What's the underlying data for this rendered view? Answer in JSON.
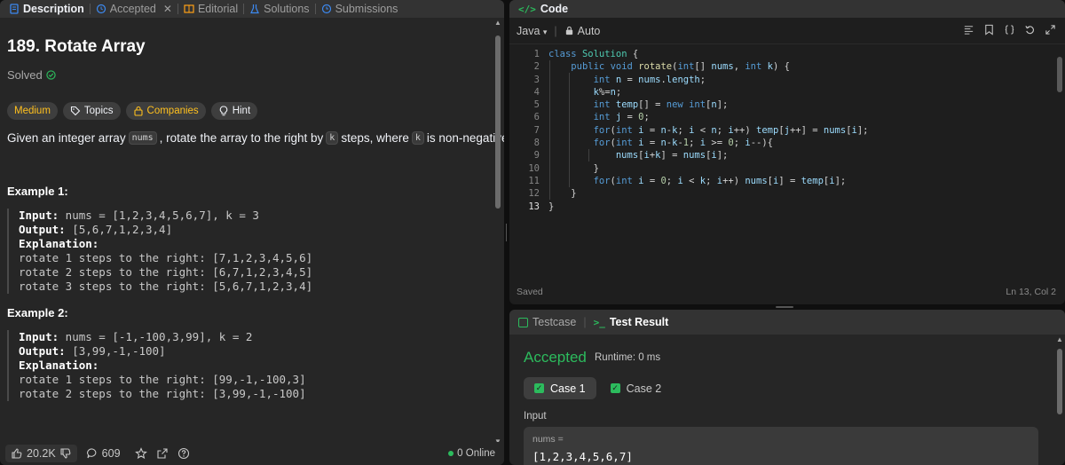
{
  "left_tabs": [
    {
      "label": "Description",
      "icon": "document-icon",
      "active": true
    },
    {
      "label": "Accepted",
      "icon": "history-icon",
      "closable": true
    },
    {
      "label": "Editorial",
      "icon": "book-icon"
    },
    {
      "label": "Solutions",
      "icon": "flask-icon"
    },
    {
      "label": "Submissions",
      "icon": "clock-icon"
    }
  ],
  "problem": {
    "title": "189. Rotate Array",
    "solved_label": "Solved",
    "chips": {
      "difficulty": "Medium",
      "topics": "Topics",
      "companies": "Companies",
      "hint": "Hint"
    },
    "desc": {
      "part1": "Given an integer array",
      "code1": "nums",
      "part2": ", rotate the array to the right by",
      "code2": "k",
      "part3": "steps, where",
      "code3": "k",
      "part4": "is non-negative."
    },
    "example1": {
      "title": "Example 1:",
      "input_label": "Input:",
      "input_value": " nums = [1,2,3,4,5,6,7], k = 3",
      "output_label": "Output:",
      "output_value": " [5,6,7,1,2,3,4]",
      "explanation_label": "Explanation:",
      "lines": [
        "rotate 1 steps to the right: [7,1,2,3,4,5,6]",
        "rotate 2 steps to the right: [6,7,1,2,3,4,5]",
        "rotate 3 steps to the right: [5,6,7,1,2,3,4]"
      ]
    },
    "example2": {
      "title": "Example 2:",
      "input_label": "Input:",
      "input_value": " nums = [-1,-100,3,99], k = 2",
      "output_label": "Output:",
      "output_value": " [3,99,-1,-100]",
      "explanation_label": "Explanation:",
      "lines": [
        "rotate 1 steps to the right: [99,-1,-100,3]",
        "rotate 2 steps to the right: [3,99,-1,-100]"
      ]
    }
  },
  "bottom_bar": {
    "likes": "20.2K",
    "comments": "609",
    "online": "0 Online"
  },
  "code_panel": {
    "title": "Code",
    "language": "Java",
    "mode": "Auto",
    "status": "Saved",
    "cursor": "Ln 13, Col 2",
    "line_numbers": [
      "1",
      "2",
      "3",
      "4",
      "5",
      "6",
      "7",
      "8",
      "9",
      "10",
      "11",
      "12",
      "13"
    ]
  },
  "test_panel": {
    "tab_testcase": "Testcase",
    "tab_result": "Test Result",
    "status": "Accepted",
    "runtime": "Runtime: 0 ms",
    "case1": "Case 1",
    "case2": "Case 2",
    "input_label": "Input",
    "var_name": "nums =",
    "var_value": "[1,2,3,4,5,6,7]"
  },
  "colors": {
    "accent_green": "#2cbb5d",
    "medium_yellow": "#ffc01e",
    "background": "#262626"
  }
}
